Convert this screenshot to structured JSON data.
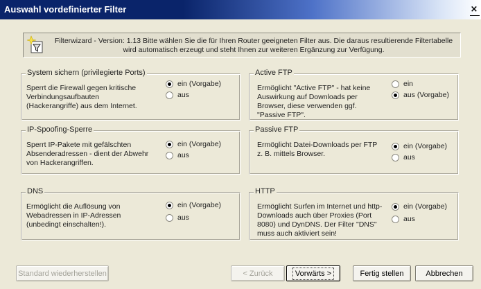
{
  "window": {
    "title": "Auswahl vordefinierter Filter",
    "close_glyph": "×"
  },
  "banner": {
    "icon": "filter-wizard-icon",
    "line1": "Filterwizard - Version: 1.13  Bitte wählen Sie die für Ihren Router geeigneten  Filter aus. Die daraus resultierende Filtertabelle",
    "line2": "wird automatisch erzeugt und steht Ihnen zur weiteren Ergänzung zur Verfügung."
  },
  "groups": [
    {
      "legend": "System sichern (privilegierte Ports)",
      "desc": [
        "Sperrt die Firewall gegen kritische",
        "Verbindungsaufbauten",
        "(Hackerangriffe) aus dem Internet."
      ],
      "options": [
        "ein (Vorgabe)",
        "aus"
      ],
      "selected": "ein (Vorgabe)"
    },
    {
      "legend": "Active FTP",
      "desc": [
        "Ermöglicht \"Active FTP\" - hat keine",
        "Auswirkung auf Downloads per",
        "Browser, diese verwenden ggf.",
        "\"Passive FTP\"."
      ],
      "options": [
        "ein",
        "aus (Vorgabe)"
      ],
      "selected": "aus (Vorgabe)"
    },
    {
      "legend": "IP-Spoofing-Sperre",
      "desc": [
        "Sperrt IP-Pakete mit gefälschten",
        "Absenderadressen - dient der Abwehr",
        "von Hackerangriffen."
      ],
      "options": [
        "ein (Vorgabe)",
        "aus"
      ],
      "selected": "ein (Vorgabe)"
    },
    {
      "legend": "Passive FTP",
      "desc": [
        "Ermöglicht Datei-Downloads per FTP",
        "z. B. mittels Browser."
      ],
      "options": [
        "ein (Vorgabe)",
        "aus"
      ],
      "selected": "ein (Vorgabe)"
    },
    {
      "legend": "DNS",
      "desc": [
        "Ermöglicht die Auflösung von",
        "Webadressen in IP-Adressen",
        "(unbedingt einschalten!)."
      ],
      "options": [
        "ein (Vorgabe)",
        "aus"
      ],
      "selected": "ein (Vorgabe)"
    },
    {
      "legend": "HTTP",
      "desc": [
        "Ermöglicht Surfen im Internet und http-",
        "Downloads auch über Proxies (Port",
        "8080) und DynDNS. Der Filter \"DNS\"",
        "muss auch aktiviert sein!"
      ],
      "options": [
        "ein (Vorgabe)",
        "aus"
      ],
      "selected": "ein (Vorgabe)"
    }
  ],
  "buttons": {
    "restore": "Standard wiederherstellen",
    "back": "< Zurück",
    "next": "Vorwärts >",
    "finish": "Fertig stellen",
    "cancel": "Abbrechen"
  }
}
